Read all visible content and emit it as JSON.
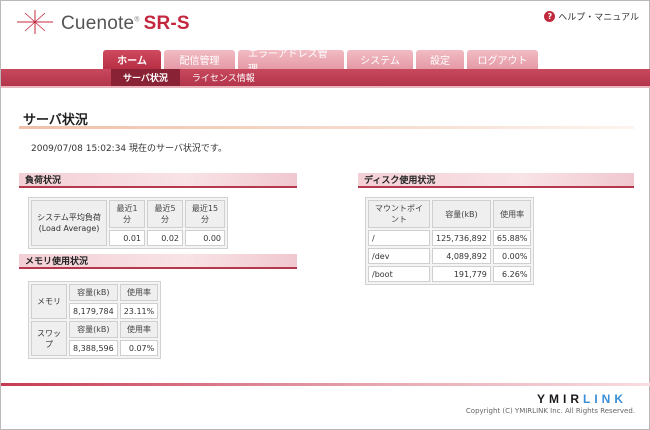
{
  "header": {
    "logo_text": "Cuenote",
    "logo_reg": "®",
    "logo_product": "SR-S",
    "help_label": "ヘルプ・マニュアル"
  },
  "tabs": [
    {
      "label": "ホーム",
      "active": true
    },
    {
      "label": "配信管理",
      "active": false
    },
    {
      "label": "エラーアドレス管理",
      "active": false
    },
    {
      "label": "システム",
      "active": false
    },
    {
      "label": "設定",
      "active": false
    },
    {
      "label": "ログアウト",
      "active": false
    }
  ],
  "subtabs": [
    {
      "label": "サーバ状況",
      "active": true
    },
    {
      "label": "ライセンス情報",
      "active": false
    }
  ],
  "page": {
    "title": "サーバ状況",
    "timestamp": "2009/07/08 15:02:34 現在のサーバ状況です。"
  },
  "load": {
    "section_title": "負荷状況",
    "row_label_1": "システム平均負荷",
    "row_label_2": "(Load Average)",
    "headers": [
      "最近1分",
      "最近5分",
      "最近15分"
    ],
    "values": [
      "0.01",
      "0.02",
      "0.00"
    ]
  },
  "memory": {
    "section_title": "メモリ使用状況",
    "capacity_header": "容量(kB)",
    "usage_header": "使用率",
    "rows": [
      {
        "label": "メモリ",
        "capacity": "8,179,784",
        "usage": "23.11%"
      },
      {
        "label": "スワップ",
        "capacity": "8,388,596",
        "usage": "0.07%"
      }
    ]
  },
  "disk": {
    "section_title": "ディスク使用状況",
    "headers": [
      "マウントポイント",
      "容量(kB)",
      "使用率"
    ],
    "rows": [
      {
        "mount": "/",
        "capacity": "125,736,892",
        "usage": "65.88%"
      },
      {
        "mount": "/dev",
        "capacity": "4,089,892",
        "usage": "0.00%"
      },
      {
        "mount": "/boot",
        "capacity": "191,779",
        "usage": "6.26%"
      }
    ]
  },
  "footer": {
    "brand_a": "YMIR",
    "brand_b": "LINK",
    "copyright": "Copyright (C) YMIRLINK Inc. All Rights Reserved."
  },
  "colors": {
    "accent": "#b5384c",
    "tab_inactive": "#e59aa6",
    "brand_blue": "#3a8fd6"
  }
}
